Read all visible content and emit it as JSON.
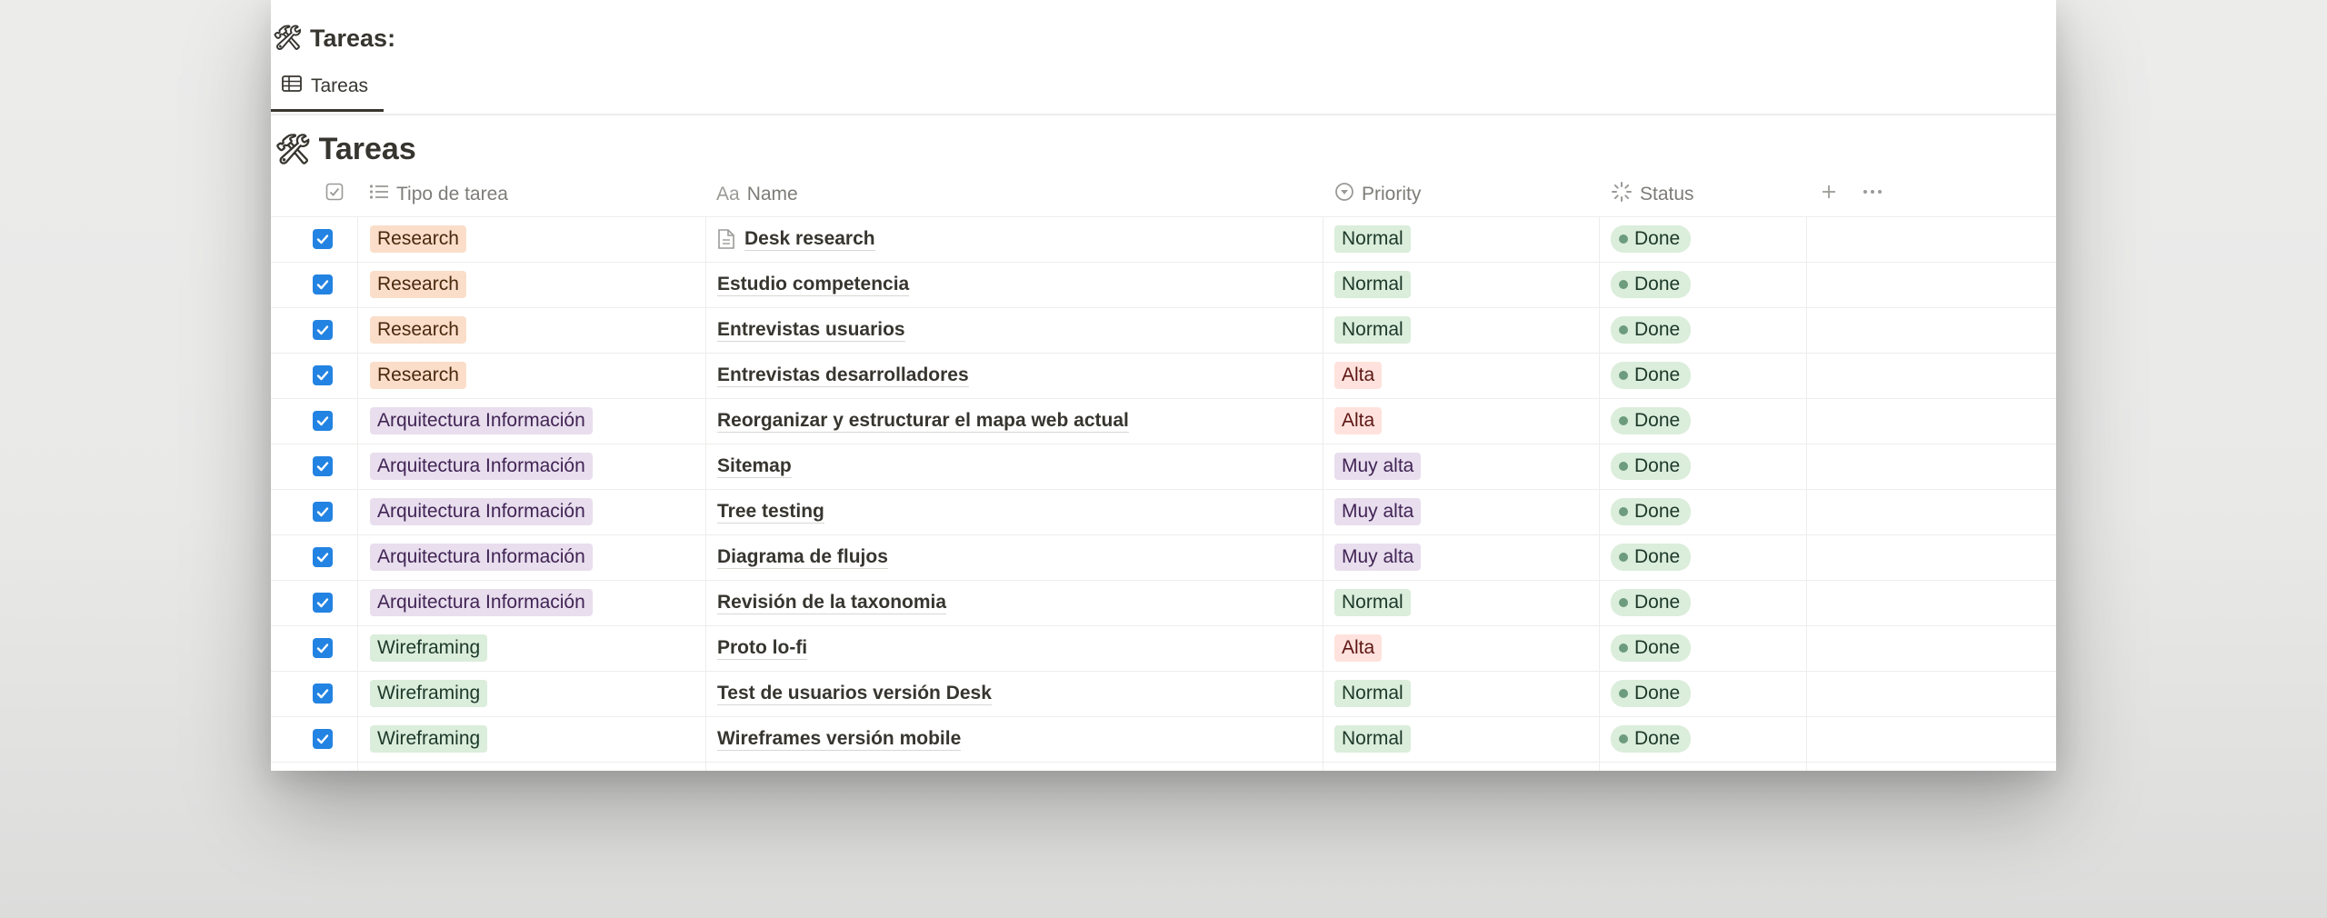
{
  "page": {
    "emoji": "🛠",
    "heading": "Tareas:"
  },
  "view_tab": {
    "label": "Tareas",
    "icon": "table-icon"
  },
  "database": {
    "emoji": "🛠",
    "title": "Tareas"
  },
  "columns": {
    "checkbox_icon": "checkbox-header-icon",
    "tipo": "Tipo de tarea",
    "name": "Name",
    "name_prefix": "Aa",
    "priority": "Priority",
    "status": "Status",
    "add_icon": "plus-icon",
    "more_icon": "more-icon"
  },
  "colors": {
    "checkbox": "#2383e2",
    "research": "#fadec9",
    "arquitectura": "#e8deee",
    "wireframing": "#dbeddb",
    "normal": "#dbeddb",
    "alta": "#ffe2dd",
    "muy_alta": "#e8deee",
    "done": "#dbeddb"
  },
  "rows": [
    {
      "checked": true,
      "tipo": "Research",
      "name": "Desk research",
      "priority": "Normal",
      "status": "Done"
    },
    {
      "checked": true,
      "tipo": "Research",
      "name": "Estudio competencia",
      "priority": "Normal",
      "status": "Done"
    },
    {
      "checked": true,
      "tipo": "Research",
      "name": "Entrevistas usuarios",
      "priority": "Normal",
      "status": "Done"
    },
    {
      "checked": true,
      "tipo": "Research",
      "name": "Entrevistas desarrolladores",
      "priority": "Alta",
      "status": "Done"
    },
    {
      "checked": true,
      "tipo": "Arquitectura Información",
      "name": "Reorganizar y estructurar el mapa web actual",
      "priority": "Alta",
      "status": "Done"
    },
    {
      "checked": true,
      "tipo": "Arquitectura Información",
      "name": "Sitemap",
      "priority": "Muy alta",
      "status": "Done"
    },
    {
      "checked": true,
      "tipo": "Arquitectura Información",
      "name": "Tree testing",
      "priority": "Muy alta",
      "status": "Done"
    },
    {
      "checked": true,
      "tipo": "Arquitectura Información",
      "name": "Diagrama de flujos",
      "priority": "Muy alta",
      "status": "Done"
    },
    {
      "checked": true,
      "tipo": "Arquitectura Información",
      "name": "Revisión de la taxonomia",
      "priority": "Normal",
      "status": "Done"
    },
    {
      "checked": true,
      "tipo": "Wireframing",
      "name": "Proto lo-fi",
      "priority": "Alta",
      "status": "Done"
    },
    {
      "checked": true,
      "tipo": "Wireframing",
      "name": "Test de usuarios versión Desk",
      "priority": "Normal",
      "status": "Done"
    },
    {
      "checked": true,
      "tipo": "Wireframing",
      "name": "Wireframes versión mobile",
      "priority": "Normal",
      "status": "Done"
    }
  ]
}
